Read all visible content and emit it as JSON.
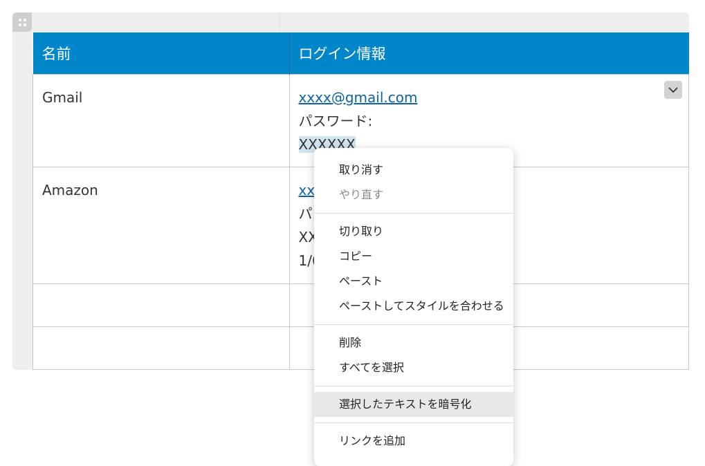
{
  "table": {
    "headers": [
      "名前",
      "ログイン情報"
    ],
    "header_color": "#0086c9",
    "rows": [
      {
        "name": "Gmail",
        "login_link": "xxxx@gmail.com",
        "password_label": "パスワード:",
        "password_value": "XXXXXX"
      },
      {
        "name": "Amazon",
        "login_link_partial": "xxxx",
        "password_label_partial": "パス",
        "password_value_partial": "XXX",
        "extra_partial": "1/6"
      },
      {
        "name": ""
      },
      {
        "name": ""
      }
    ]
  },
  "icons": {
    "drag_handle": "drag-handle-icon",
    "dropdown": "chevron-down-icon"
  },
  "context_menu": {
    "group1": [
      {
        "label": "取り消す",
        "disabled": false
      },
      {
        "label": "やり直す",
        "disabled": true
      }
    ],
    "group2": [
      {
        "label": "切り取り"
      },
      {
        "label": "コピー"
      },
      {
        "label": "ペースト"
      },
      {
        "label": "ペーストしてスタイルを合わせる"
      }
    ],
    "group3": [
      {
        "label": "削除"
      },
      {
        "label": "すべてを選択"
      }
    ],
    "group4": [
      {
        "label": "選択したテキストを暗号化",
        "highlighted": true
      }
    ],
    "group5": [
      {
        "label": "リンクを追加"
      }
    ]
  }
}
